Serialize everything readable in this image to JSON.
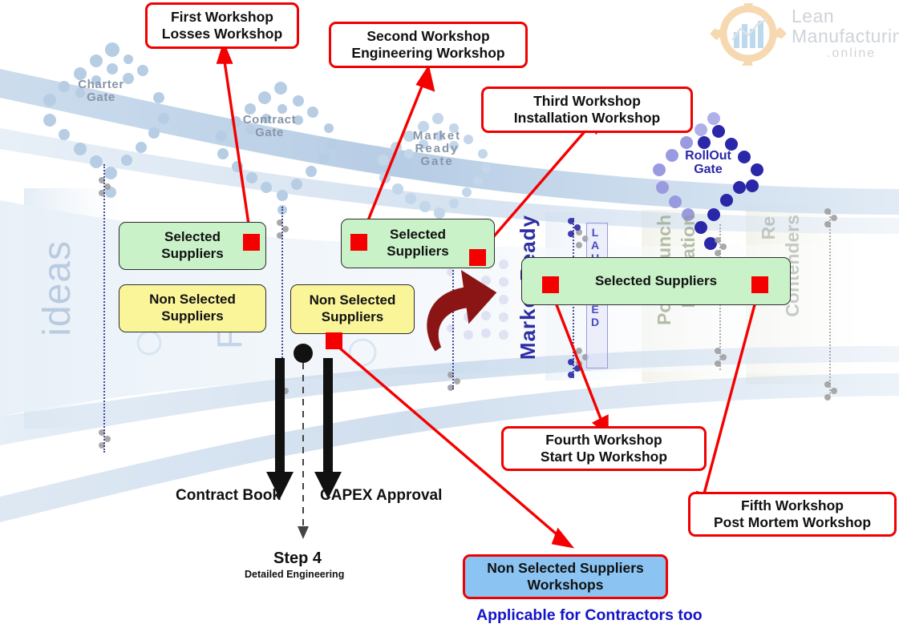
{
  "diagram": {
    "title_logo": {
      "line1": "Lean",
      "line2": "Manufacturing",
      "line3": ".online",
      "icon": "gear-bar-chart-icon"
    },
    "gates": [
      {
        "id": "charter",
        "label": "Charter\nGate"
      },
      {
        "id": "contract",
        "label": "Contract\nGate"
      },
      {
        "id": "market",
        "label": "Market\nReady\nGate"
      },
      {
        "id": "rollout",
        "label": "RollOut\nGate"
      }
    ],
    "stage_words": {
      "ideas": "ideas",
      "feasibility": "Fea",
      "market_ready": "Market Ready",
      "launched": "LAUNCHED",
      "post_launch": "Post Launch",
      "evaluation": "Evaluation",
      "contenders": "Contenders",
      "re": "Re"
    },
    "supplier_boxes": [
      {
        "id": "selected-1",
        "label": "Selected\nSuppliers",
        "type": "green"
      },
      {
        "id": "nonselected-1",
        "label": "Non Selected\nSuppliers",
        "type": "yellow"
      },
      {
        "id": "selected-2",
        "label": "Selected\nSuppliers",
        "type": "green"
      },
      {
        "id": "nonselected-2",
        "label": "Non Selected\nSuppliers",
        "type": "yellow"
      },
      {
        "id": "selected-3",
        "label": "Selected Suppliers",
        "type": "green"
      }
    ],
    "callouts": [
      {
        "id": "first",
        "label": "First Workshop\nLosses Workshop"
      },
      {
        "id": "second",
        "label": "Second Workshop\nEngineering Workshop"
      },
      {
        "id": "third",
        "label": "Third Workshop\nInstallation Workshop"
      },
      {
        "id": "fourth",
        "label": "Fourth Workshop\nStart Up Workshop"
      },
      {
        "id": "fifth",
        "label": "Fifth Workshop\nPost Mortem Workshop"
      },
      {
        "id": "nonselected",
        "label": "Non Selected Suppliers\nWorkshops",
        "style": "blue"
      }
    ],
    "bottom": {
      "contract_book": "Contract Book",
      "capex_approval": "CAPEX Approval",
      "step_title": "Step 4",
      "step_subtitle": "Detailed Engineering",
      "footnote": "Applicable for Contractors too"
    },
    "colors": {
      "callout_border": "#f00000",
      "marker": "#f40000",
      "green_box": "#c9f2c9",
      "yellow_box": "#fbf59a",
      "blue_box": "#8bc4f2",
      "footnote": "#1414c8",
      "rollout_gate": "#2a28a8",
      "curved_arrow": "#8b1414",
      "funnel": "#b8cde4"
    }
  }
}
